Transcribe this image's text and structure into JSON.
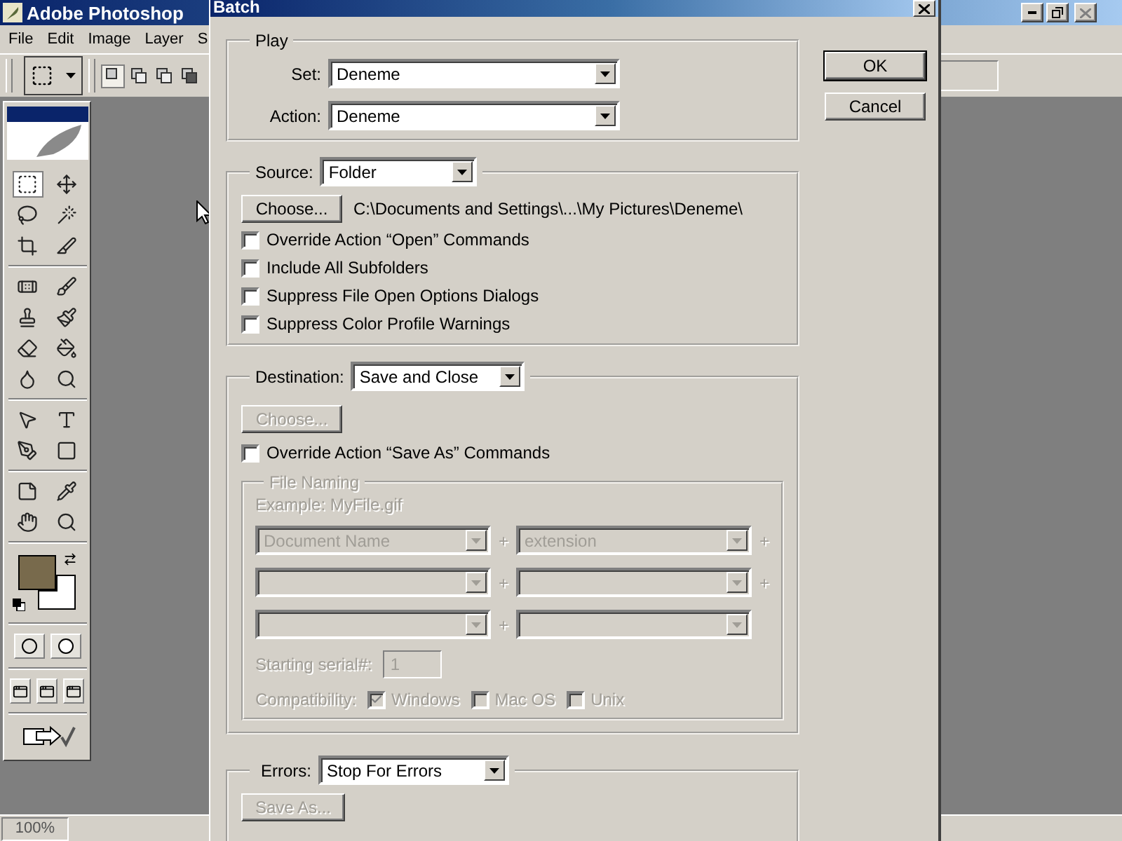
{
  "app": {
    "title": "Adobe Photoshop",
    "menu": [
      "File",
      "Edit",
      "Image",
      "Layer",
      "S"
    ],
    "swatches": [
      {
        "kind": "foreground",
        "color": "#786a4c"
      },
      {
        "kind": "background",
        "color": "#ffffff"
      }
    ],
    "zoom": "100%"
  },
  "dialog": {
    "title": "Batch",
    "buttons": [
      {
        "label": "OK",
        "default": true
      },
      {
        "label": "Cancel",
        "default": false
      }
    ],
    "play": {
      "legend": "Play",
      "rows": [
        {
          "label": "Set:",
          "value": "Deneme"
        },
        {
          "label": "Action:",
          "value": "Deneme"
        }
      ]
    },
    "source": {
      "label": "Source:",
      "value": "Folder",
      "choose": {
        "label": "Choose...",
        "disabled": false
      },
      "path": "C:\\Documents and Settings\\...\\My Pictures\\Deneme\\",
      "options": [
        {
          "label": "Override Action “Open” Commands",
          "checked": false
        },
        {
          "label": "Include All Subfolders",
          "checked": false
        },
        {
          "label": "Suppress File Open Options Dialogs",
          "checked": false
        },
        {
          "label": "Suppress Color Profile Warnings",
          "checked": false
        }
      ]
    },
    "destination": {
      "label": "Destination:",
      "value": "Save and Close",
      "choose": {
        "label": "Choose...",
        "disabled": true
      },
      "options": [
        {
          "label": "Override Action “Save As” Commands",
          "checked": false
        }
      ],
      "file_naming": {
        "legend": "File Naming",
        "disabled": true,
        "example": "Example: MyFile.gif",
        "fields": [
          {
            "kind": "dropdown",
            "value": "Document Name",
            "plus": "+"
          },
          {
            "kind": "dropdown",
            "value": "extension",
            "plus": "+"
          },
          {
            "kind": "dropdown",
            "plus": "+"
          },
          {
            "kind": "dropdown",
            "plus": "+"
          },
          {
            "kind": "dropdown",
            "plus": "+"
          },
          {
            "kind": "dropdown"
          }
        ],
        "serial": {
          "label": "Starting serial#:",
          "value": "1"
        },
        "compatibility": {
          "label": "Compatibility:",
          "options": [
            {
              "label": "Windows",
              "checked": true
            },
            {
              "label": "Mac OS",
              "checked": false
            },
            {
              "label": "Unix",
              "checked": false
            }
          ]
        }
      }
    },
    "errors": {
      "label": "Errors:",
      "value": "Stop For Errors",
      "save_as": {
        "label": "Save As...",
        "disabled": true
      }
    }
  }
}
